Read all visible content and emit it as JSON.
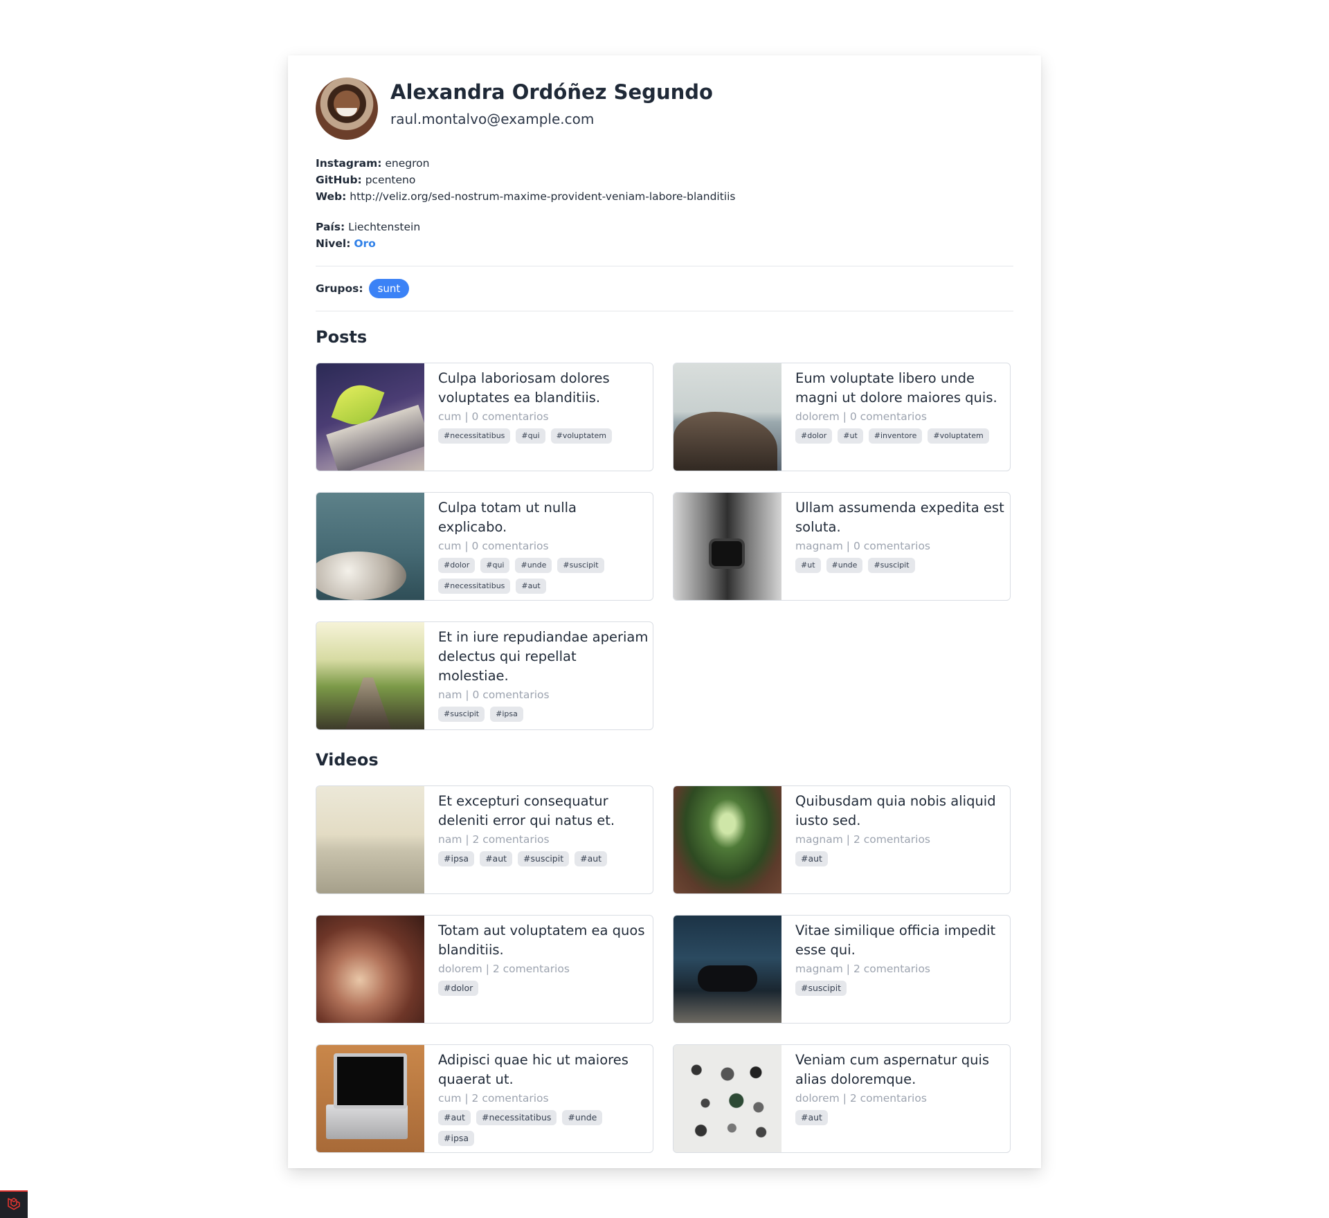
{
  "profile": {
    "name": "Alexandra Ordóñez Segundo",
    "email": "raul.montalvo@example.com",
    "instagram_label": "Instagram:",
    "instagram": "enegron",
    "github_label": "GitHub:",
    "github": "pcenteno",
    "web_label": "Web:",
    "web": "http://veliz.org/sed-nostrum-maxime-provident-veniam-labore-blanditiis",
    "country_label": "País:",
    "country": "Liechtenstein",
    "level_label": "Nivel:",
    "level": "Oro",
    "groups_label": "Grupos:",
    "groups": [
      "sunt"
    ]
  },
  "posts_title": "Posts",
  "posts": [
    {
      "title": "Culpa laboriosam dolores voluptates ea blanditiis.",
      "category": "cum",
      "comments": "0 comentarios",
      "tags": [
        "#necessitatibus",
        "#qui",
        "#voluptatem"
      ]
    },
    {
      "title": "Eum voluptate libero unde magni ut dolore maiores quis.",
      "category": "dolorem",
      "comments": "0 comentarios",
      "tags": [
        "#dolor",
        "#ut",
        "#inventore",
        "#voluptatem"
      ]
    },
    {
      "title": "Culpa totam ut nulla explicabo.",
      "category": "cum",
      "comments": "0 comentarios",
      "tags": [
        "#dolor",
        "#qui",
        "#unde",
        "#suscipit",
        "#necessitatibus",
        "#aut"
      ]
    },
    {
      "title": "Ullam assumenda expedita est soluta.",
      "category": "magnam",
      "comments": "0 comentarios",
      "tags": [
        "#ut",
        "#unde",
        "#suscipit"
      ]
    },
    {
      "title": "Et in iure repudiandae aperiam delectus qui repellat molestiae.",
      "category": "nam",
      "comments": "0 comentarios",
      "tags": [
        "#suscipit",
        "#ipsa"
      ]
    }
  ],
  "videos_title": "Videos",
  "videos": [
    {
      "title": "Et excepturi consequatur deleniti error qui natus et.",
      "category": "nam",
      "comments": "2 comentarios",
      "tags": [
        "#ipsa",
        "#aut",
        "#suscipit",
        "#aut"
      ]
    },
    {
      "title": "Quibusdam quia nobis aliquid iusto sed.",
      "category": "magnam",
      "comments": "2 comentarios",
      "tags": [
        "#aut"
      ]
    },
    {
      "title": "Totam aut voluptatem ea quos blanditiis.",
      "category": "dolorem",
      "comments": "2 comentarios",
      "tags": [
        "#dolor"
      ]
    },
    {
      "title": "Vitae similique officia impedit esse qui.",
      "category": "magnam",
      "comments": "2 comentarios",
      "tags": [
        "#suscipit"
      ]
    },
    {
      "title": "Adipisci quae hic ut maiores quaerat ut.",
      "category": "cum",
      "comments": "2 comentarios",
      "tags": [
        "#aut",
        "#necessitatibus",
        "#unde",
        "#ipsa"
      ]
    },
    {
      "title": "Veniam cum aspernatur quis alias doloremque.",
      "category": "dolorem",
      "comments": "2 comentarios",
      "tags": [
        "#aut"
      ]
    }
  ],
  "colors": {
    "accent": "#3b82f6",
    "level": "#2f80e8",
    "badge_border": "#e3342f"
  },
  "icons": {
    "corner": "laravel-logo-icon"
  }
}
